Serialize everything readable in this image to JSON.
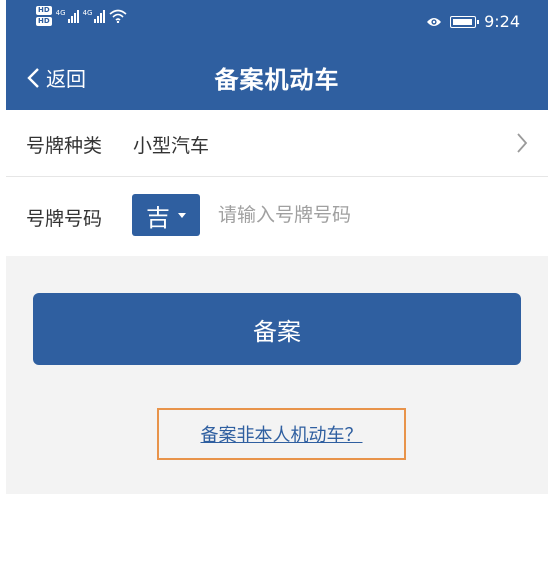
{
  "status_bar": {
    "hd_badges": [
      "HD",
      "HD"
    ],
    "network_tags": [
      "4G",
      "4G"
    ],
    "time": "9:24"
  },
  "nav": {
    "back_label": "返回",
    "title": "备案机动车"
  },
  "form": {
    "plate_type": {
      "label": "号牌种类",
      "value": "小型汽车"
    },
    "plate_number": {
      "label": "号牌号码",
      "province": "吉",
      "placeholder": "请输入号牌号码",
      "value": ""
    }
  },
  "actions": {
    "submit_label": "备案",
    "other_owner_link": "备案非本人机动车？"
  },
  "colors": {
    "primary": "#2f5fa0",
    "highlight": "#e8934a",
    "page_bg": "#f3f3f3"
  }
}
